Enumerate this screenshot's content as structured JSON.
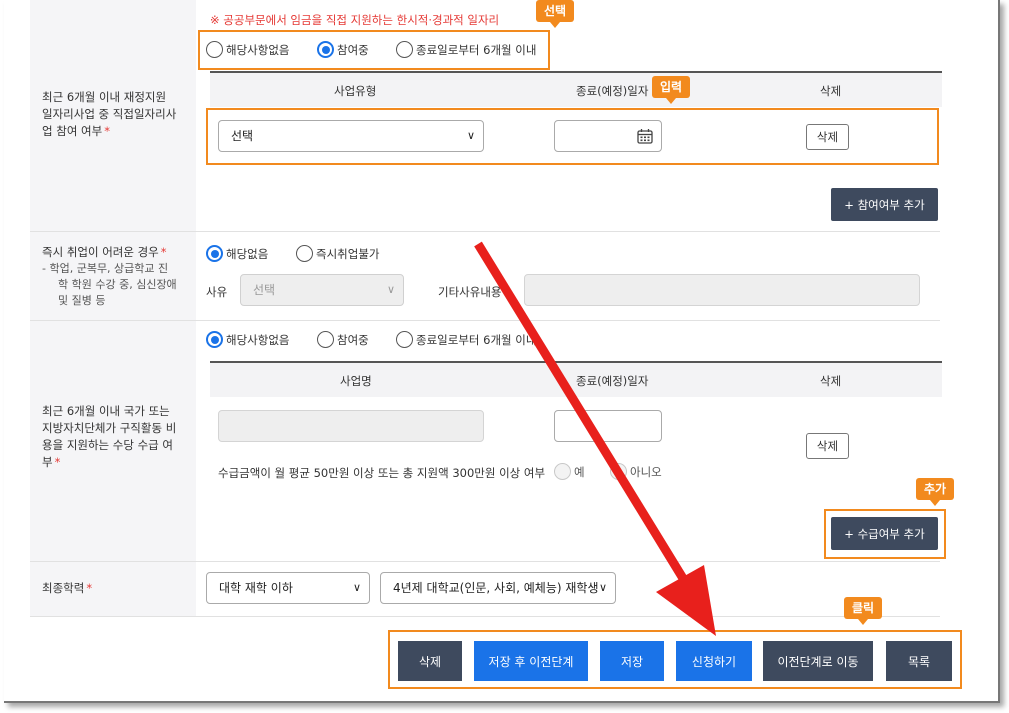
{
  "notice": "※ 공공부문에서 임금을 직접 지원하는 한시적·경과적 일자리",
  "annotations": {
    "select_tag": "선택",
    "input_tag": "입력",
    "add_tag": "추가",
    "click_tag": "클릭"
  },
  "section1": {
    "label": [
      "최근 6개월 이내 재정지원",
      "일자리사업 중 직접일자리사",
      "업 참여 여부"
    ],
    "required_mark": "*",
    "radios": [
      {
        "label": "해당사항없음",
        "checked": false
      },
      {
        "label": "참여중",
        "checked": true
      },
      {
        "label": "종료일로부터 6개월 이내",
        "checked": false
      }
    ],
    "columns": [
      "사업유형",
      "종료(예정)일자",
      "삭제"
    ],
    "type_select": "선택",
    "date_value": "",
    "delete_label": "삭제",
    "add_button": "+ 참여여부 추가"
  },
  "section2": {
    "label": "즉시 취업이 어려운 경우",
    "required_mark": "*",
    "notes": [
      "-  학업, 군복무, 상급학교 진",
      "학 학원 수강 중, 심신장애",
      "및 질병 등"
    ],
    "radios": [
      {
        "label": "해당없음",
        "checked": true
      },
      {
        "label": "즉시취업불가",
        "checked": false
      }
    ],
    "reason_label": "사유",
    "reason_select": "선택",
    "other_label": "기타사유내용",
    "other_value": ""
  },
  "section3": {
    "label": [
      "최근 6개월 이내 국가 또는",
      "지방자치단체가 구직활동 비",
      "용을 지원하는 수당 수급 여",
      "부"
    ],
    "required_mark": "*",
    "radios": [
      {
        "label": "해당사항없음",
        "checked": true
      },
      {
        "label": "참여중",
        "checked": false
      },
      {
        "label": "종료일로부터 6개월 이내",
        "checked": false
      }
    ],
    "columns": [
      "사업명",
      "종료(예정)일자",
      "삭제"
    ],
    "name_value": "",
    "date_value": "",
    "delete_label": "삭제",
    "question": "수급금액이 월 평균 50만원 이상 또는 총 지원액 300만원 이상 여부",
    "yes_label": "예",
    "no_label": "아니오",
    "add_button": "+ 수급여부 추가"
  },
  "section4": {
    "label": "최종학력",
    "required_mark": "*",
    "select1": "대학 재학 이하",
    "select2": "4년제 대학교(인문, 사회, 예체능) 재학생"
  },
  "footer_buttons": {
    "delete": "삭제",
    "save_prev": "저장 후 이전단계",
    "save": "저장",
    "apply": "신청하기",
    "prev": "이전단계로 이동",
    "list": "목록"
  },
  "colors": {
    "accent_blue": "#1a73e8",
    "dark_button": "#3e4a5e",
    "annotation_orange": "#f28a1e",
    "arrow_red": "#e8201c",
    "required_red": "#e53935"
  }
}
